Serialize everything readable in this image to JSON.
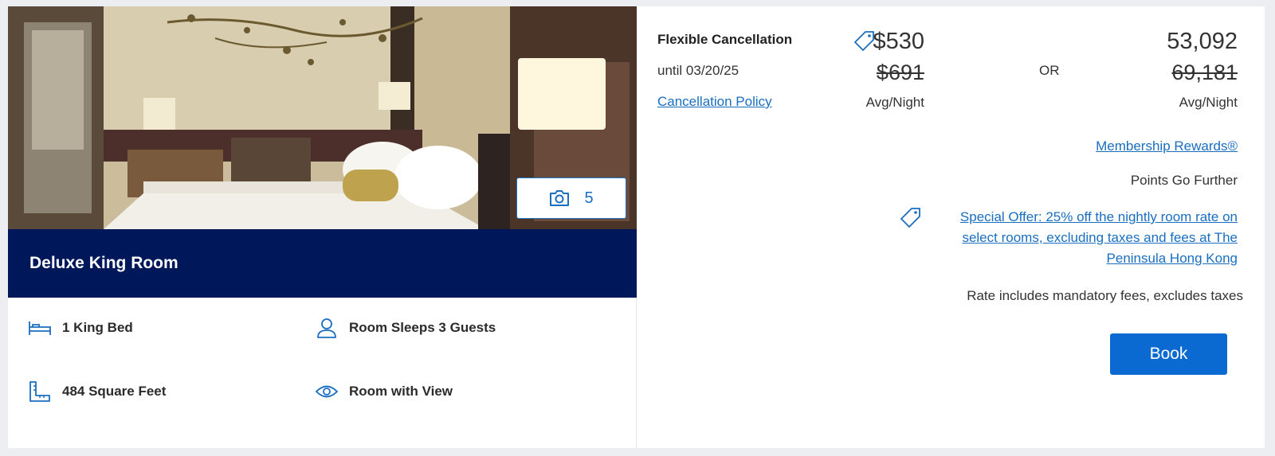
{
  "room": {
    "name": "Deluxe King Room",
    "photo_count": "5",
    "amenities": [
      {
        "icon": "bed-icon",
        "label": "1 King Bed"
      },
      {
        "icon": "person-icon",
        "label": "Room Sleeps 3 Guests"
      },
      {
        "icon": "ruler-icon",
        "label": "484 Square Feet"
      },
      {
        "icon": "eye-icon",
        "label": "Room with View"
      }
    ]
  },
  "rate": {
    "title": "Flexible Cancellation",
    "until": "until 03/20/25",
    "policy_link": "Cancellation Policy",
    "cash_price": "$530",
    "cash_original": "$691",
    "per_night": "Avg/Night",
    "or_label": "OR",
    "points_price": "53,092",
    "points_original": "69,181",
    "points_per_night": "Avg/Night",
    "membership_link": "Membership Rewards®",
    "points_tagline": "Points Go Further",
    "special_offer": "Special Offer: 25% off the nightly room rate on select rooms, excluding taxes and fees at The Peninsula Hong Kong",
    "fees_note": "Rate includes mandatory fees, excludes taxes",
    "book_label": "Book"
  },
  "colors": {
    "brand_navy": "#00175a",
    "link_blue": "#1a6ec0",
    "button_blue": "#0a6ad1"
  }
}
